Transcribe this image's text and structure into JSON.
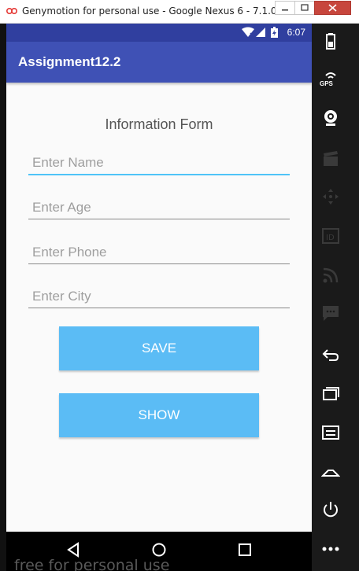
{
  "window": {
    "title": "Genymotion for personal use - Google Nexus 6 - 7.1.0 - ..."
  },
  "statusbar": {
    "time": "6:07",
    "icons": [
      "wifi-icon",
      "signal-icon",
      "battery-icon"
    ]
  },
  "app": {
    "title": "Assignment12.2"
  },
  "form": {
    "heading": "Information Form",
    "fields": [
      {
        "placeholder": "Enter Name",
        "value": ""
      },
      {
        "placeholder": "Enter Age",
        "value": ""
      },
      {
        "placeholder": "Enter Phone",
        "value": ""
      },
      {
        "placeholder": "Enter City",
        "value": ""
      }
    ],
    "save_label": "SAVE",
    "show_label": "SHOW"
  },
  "navbar": {
    "icons": [
      "back-icon",
      "home-icon",
      "recents-icon"
    ]
  },
  "watermark": "free for personal use",
  "sidebar": {
    "items": [
      "battery-icon",
      "gps-icon",
      "webcam-icon",
      "media-icon",
      "dpad-icon",
      "id-icon",
      "rss-icon",
      "sms-icon",
      "back-icon",
      "recents-icon",
      "menu-icon",
      "home-icon",
      "power-icon",
      "more-icon"
    ],
    "gps_label": "GPS"
  },
  "colors": {
    "status_bar": "#303f9f",
    "app_bar": "#3f51b5",
    "accent": "#4fc3f7",
    "button": "#5bbcf5",
    "title_close": "#c7463d"
  }
}
